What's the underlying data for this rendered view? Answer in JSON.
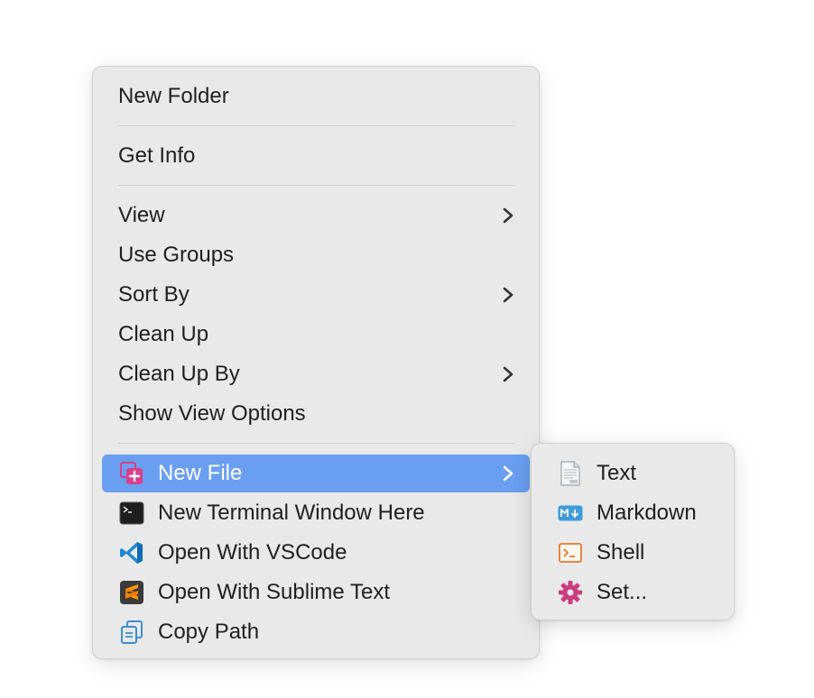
{
  "context_menu": {
    "items": {
      "new_folder": "New Folder",
      "get_info": "Get Info",
      "view": "View",
      "use_groups": "Use Groups",
      "sort_by": "Sort By",
      "clean_up": "Clean Up",
      "clean_up_by": "Clean Up By",
      "show_view_options": "Show View Options",
      "new_file": "New File",
      "new_terminal": "New Terminal Window Here",
      "open_vscode": "Open With VSCode",
      "open_sublime": "Open With Sublime Text",
      "copy_path": "Copy Path"
    },
    "highlight_color": "#6a9ef0"
  },
  "new_file_submenu": {
    "items": {
      "text": "Text",
      "markdown": "Markdown",
      "shell": "Shell",
      "set": "Set..."
    }
  },
  "icons": {
    "new_file": "new-file-icon",
    "terminal": "terminal-icon",
    "vscode": "vscode-icon",
    "sublime": "sublime-text-icon",
    "copy_path": "copy-path-icon",
    "text": "text-file-icon",
    "markdown": "markdown-icon",
    "shell": "shell-icon",
    "set": "gear-icon"
  }
}
